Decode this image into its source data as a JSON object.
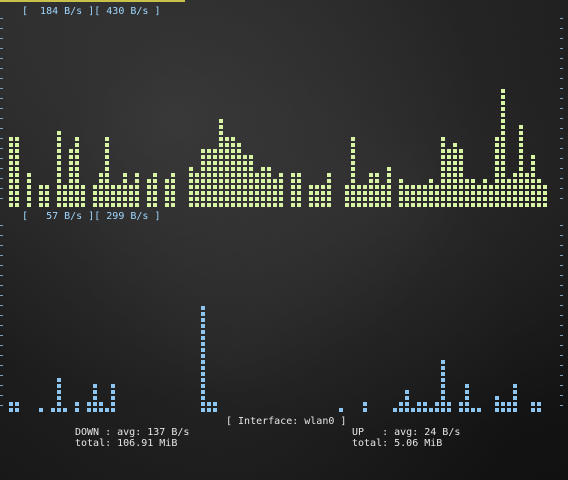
{
  "upper": {
    "header": "[  184 B/s ][ 430 B/s ]",
    "color": "#d8f2a6",
    "levels": [
      12,
      12,
      0,
      6,
      0,
      4,
      4,
      0,
      13,
      4,
      10,
      12,
      4,
      0,
      4,
      6,
      12,
      4,
      4,
      6,
      4,
      6,
      0,
      5,
      6,
      0,
      5,
      6,
      0,
      0,
      7,
      6,
      10,
      10,
      10,
      15,
      12,
      12,
      11,
      9,
      9,
      6,
      7,
      7,
      5,
      6,
      0,
      6,
      6,
      0,
      4,
      4,
      4,
      6,
      0,
      0,
      4,
      12,
      4,
      4,
      6,
      6,
      4,
      7,
      0,
      5,
      4,
      4,
      4,
      4,
      5,
      4,
      12,
      10,
      11,
      10,
      5,
      5,
      4,
      5,
      4,
      12,
      20,
      5,
      6,
      14,
      6,
      9,
      5,
      4
    ]
  },
  "lower": {
    "header": "[   57 B/s ][ 299 B/s ]",
    "color": "#8cc6f0",
    "levels": [
      2,
      2,
      0,
      0,
      0,
      1,
      0,
      1,
      6,
      1,
      0,
      2,
      0,
      2,
      5,
      2,
      1,
      5,
      0,
      0,
      0,
      0,
      0,
      0,
      0,
      0,
      0,
      0,
      0,
      0,
      0,
      0,
      18,
      2,
      2,
      0,
      0,
      0,
      0,
      0,
      0,
      0,
      0,
      0,
      0,
      0,
      0,
      0,
      0,
      0,
      0,
      0,
      0,
      0,
      0,
      1,
      0,
      0,
      0,
      2,
      0,
      0,
      0,
      0,
      1,
      2,
      4,
      1,
      2,
      2,
      1,
      2,
      9,
      2,
      0,
      2,
      5,
      1,
      1,
      0,
      0,
      3,
      2,
      2,
      5,
      0,
      0,
      2,
      2,
      0
    ]
  },
  "interface_label": "[ Interface: wlan0 ]",
  "down": {
    "avg_line": "DOWN : avg: 137 B/s",
    "total_line": "total: 106.91 MiB"
  },
  "up": {
    "avg_line": "UP   : avg: 24 B/s",
    "total_line": "total: 5.06 MiB"
  }
}
